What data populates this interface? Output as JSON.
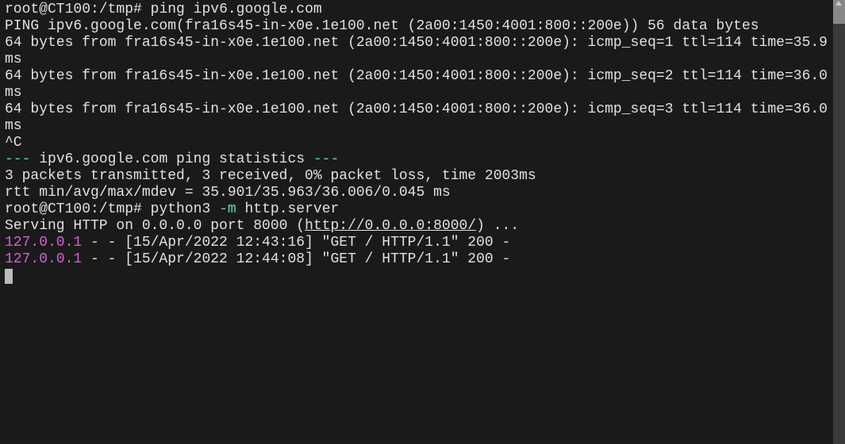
{
  "prompt1_user": "root@CT100",
  "prompt1_path": ":/tmp# ",
  "cmd1": "ping ipv6.google.com",
  "ping_header": "PING ipv6.google.com(fra16s45-in-x0e.1e100.net (2a00:1450:4001:800::200e)) 56 data bytes",
  "ping_reply1": "64 bytes from fra16s45-in-x0e.1e100.net (2a00:1450:4001:800::200e): icmp_seq=1 ttl=114 time=35.9 ms",
  "ping_reply2": "64 bytes from fra16s45-in-x0e.1e100.net (2a00:1450:4001:800::200e): icmp_seq=2 ttl=114 time=36.0 ms",
  "ping_reply3": "64 bytes from fra16s45-in-x0e.1e100.net (2a00:1450:4001:800::200e): icmp_seq=3 ttl=114 time=36.0 ms",
  "interrupt": "^C",
  "stats_sep_pre": "--- ",
  "stats_title": "ipv6.google.com ping statistics",
  "stats_sep_post": " ---",
  "stats_line1": "3 packets transmitted, 3 received, 0% packet loss, time 2003ms",
  "stats_line2": "rtt min/avg/max/mdev = 35.901/35.963/36.006/0.045 ms",
  "prompt2_user": "root@CT100",
  "prompt2_path": ":/tmp# ",
  "cmd2_a": "python3 ",
  "cmd2_flag": "-m",
  "cmd2_b": " http.server",
  "serve_pre": "Serving HTTP on 0.0.0.0 port 8000 (",
  "serve_url": "http://0.0.0.0:8000/",
  "serve_post": ") ...",
  "log1_ip": "127.0.0.1",
  "log1_rest": " - - [15/Apr/2022 12:43:16] \"GET / HTTP/1.1\" 200 -",
  "log2_ip": "127.0.0.1",
  "log2_rest": " - - [15/Apr/2022 12:44:08] \"GET / HTTP/1.1\" 200 -"
}
